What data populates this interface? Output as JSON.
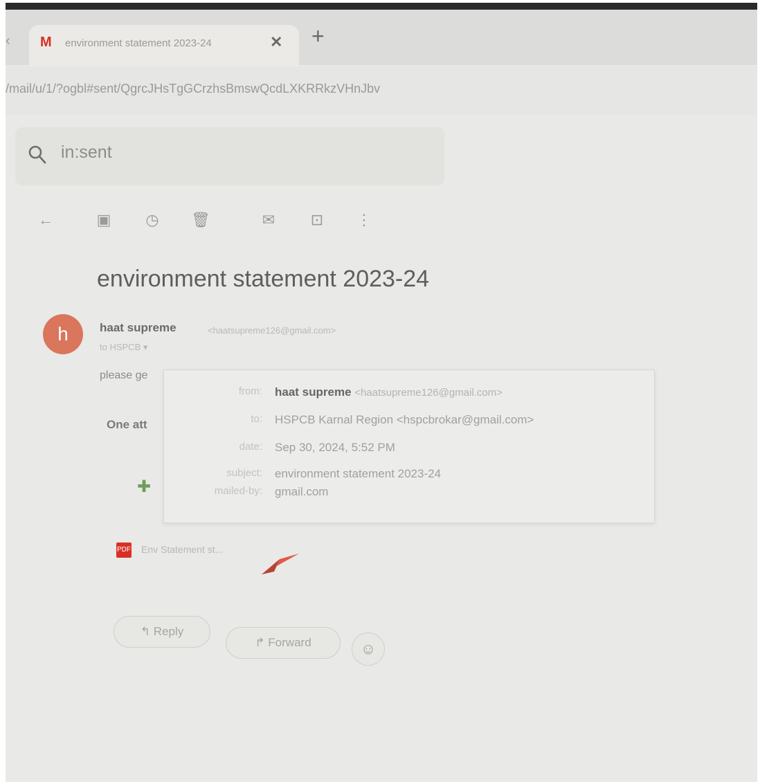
{
  "browser": {
    "tab_title": "environment statement 2023-24",
    "tab_favicon": "M",
    "tab_close": "✕",
    "new_tab": "+",
    "back_glyph": "‹",
    "url": "/mail/u/1/?ogbl#sent/QgrcJHsTgGCrzhsBmswQcdLXKRRkzVHnJbv"
  },
  "search": {
    "value": "in:sent",
    "icon": "search-icon"
  },
  "toolbar": {
    "icons": [
      "back-arrow-icon",
      "archive-icon",
      "snooze-icon",
      "delete-icon",
      "mark-unread-icon",
      "move-to-icon",
      "more-vert-icon"
    ],
    "glyphs": [
      "←",
      "▣",
      "◷",
      "🗑",
      "✉",
      "⊡",
      "⋮"
    ]
  },
  "message": {
    "subject": "environment statement 2023-24",
    "avatar_letter": "h",
    "sender_name": "haat supreme",
    "sender_email": "<haatsupreme126@gmail.com>",
    "to_line": "to HSPCB ▾",
    "body": "please ge",
    "attachments_label": "One att"
  },
  "details": {
    "from_label": "from:",
    "from_name": "haat supreme",
    "from_email": "<haatsupreme126@gmail.com>",
    "to_label": "to:",
    "to_value": "HSPCB Karnal Region <hspcbrokar@gmail.com>",
    "date_label": "date:",
    "date_value": "Sep 30, 2024, 5:52 PM",
    "subject_label": "subject:",
    "subject_value": "environment statement 2023-24",
    "mailedby_label": "mailed-by:",
    "mailedby_value": "gmail.com"
  },
  "attachment": {
    "file_name": "Env Statement st...",
    "file_icon": "PDF"
  },
  "actions": {
    "reply_label": "↰ Reply",
    "forward_label": "↱ Forward",
    "emoji_glyph": "☺"
  },
  "colors": {
    "avatar": "#d9765c",
    "gmail_red": "#d93025"
  }
}
